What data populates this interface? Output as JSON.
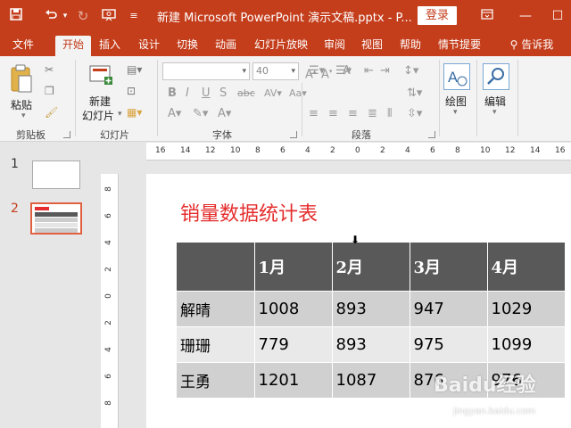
{
  "titlebar": {
    "doc_title": "新建 Microsoft PowerPoint 演示文稿.pptx  -  P...",
    "login_label": "登录",
    "qat_icons": [
      "save-icon",
      "undo-icon",
      "redo-icon",
      "slideshow-icon",
      "customize-icon"
    ],
    "window_icons": [
      "ribbon-display-icon",
      "minimize-icon",
      "maximize-icon"
    ]
  },
  "tabs": [
    {
      "label": "文件",
      "active": false
    },
    {
      "label": "开始",
      "active": true
    },
    {
      "label": "插入",
      "active": false
    },
    {
      "label": "设计",
      "active": false
    },
    {
      "label": "切换",
      "active": false
    },
    {
      "label": "动画",
      "active": false
    },
    {
      "label": "幻灯片放映",
      "active": false
    },
    {
      "label": "审阅",
      "active": false
    },
    {
      "label": "视图",
      "active": false
    },
    {
      "label": "帮助",
      "active": false
    },
    {
      "label": "情节提要",
      "active": false
    }
  ],
  "tell_me": "告诉我",
  "ribbon": {
    "paste_label": "粘贴",
    "new_slide_label_1": "新建",
    "new_slide_label_2": "幻灯片",
    "font_size": "40",
    "draw_label": "绘图",
    "edit_label": "编辑",
    "groups": {
      "clipboard": "剪贴板",
      "slides": "幻灯片",
      "font": "字体",
      "paragraph": "段落"
    }
  },
  "ruler": {
    "h_numbers": [
      "16",
      "14",
      "12",
      "10",
      "8",
      "6",
      "4",
      "2",
      "0",
      "2",
      "4",
      "6",
      "8",
      "10",
      "12",
      "14",
      "16"
    ],
    "v_numbers": [
      "8",
      "6",
      "4",
      "2",
      "0",
      "2",
      "4",
      "6",
      "8"
    ]
  },
  "thumbnails": [
    {
      "num": "1",
      "selected": false
    },
    {
      "num": "2",
      "selected": true
    }
  ],
  "slide": {
    "title": "销量数据统计表",
    "table": {
      "headers": [
        "",
        "1月",
        "2月",
        "3月",
        "4月"
      ],
      "rows": [
        [
          "解晴",
          "1008",
          "893",
          "947",
          "1029"
        ],
        [
          "珊珊",
          "779",
          "893",
          "975",
          "1099"
        ],
        [
          "王勇",
          "1201",
          "1087",
          "876",
          "976"
        ]
      ]
    }
  },
  "watermark": {
    "main": "Baidu经验",
    "sub": "jingyan.baidu.com"
  },
  "colors": {
    "accent": "#c43e1c",
    "title_red": "#e52d2d",
    "table_header": "#595959"
  }
}
